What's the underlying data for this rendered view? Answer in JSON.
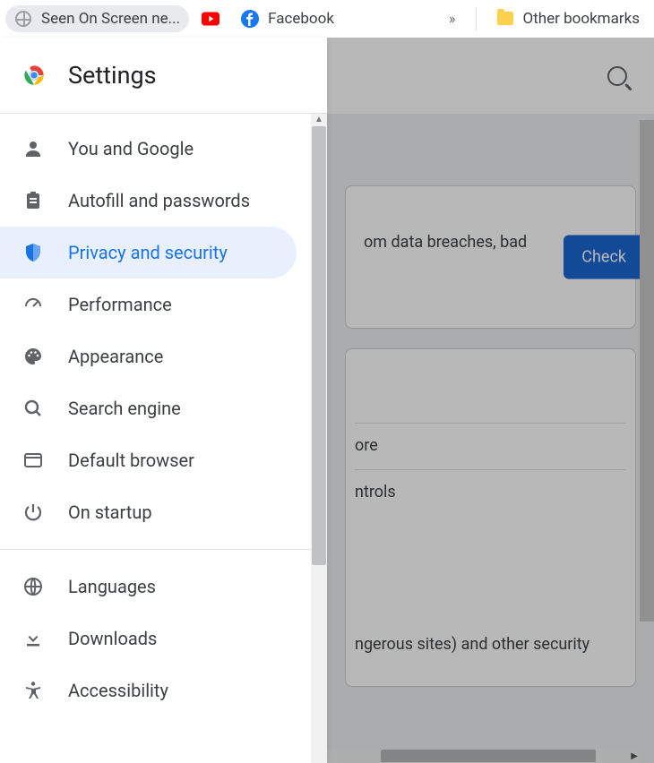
{
  "bookmarks": {
    "seen": "Seen On Screen ne...",
    "facebook": "Facebook",
    "other": "Other bookmarks",
    "overflow": "»"
  },
  "drawer": {
    "title": "Settings",
    "groups": {
      "primary": [
        {
          "id": "you-and-google",
          "label": "You and Google",
          "icon": "person"
        },
        {
          "id": "autofill",
          "label": "Autofill and passwords",
          "icon": "assignment"
        },
        {
          "id": "privacy",
          "label": "Privacy and security",
          "icon": "shield",
          "selected": true
        },
        {
          "id": "performance",
          "label": "Performance",
          "icon": "speed"
        },
        {
          "id": "appearance",
          "label": "Appearance",
          "icon": "palette"
        },
        {
          "id": "search-engine",
          "label": "Search engine",
          "icon": "search"
        },
        {
          "id": "default-browser",
          "label": "Default browser",
          "icon": "browser"
        },
        {
          "id": "on-startup",
          "label": "On startup",
          "icon": "power"
        }
      ],
      "secondary": [
        {
          "id": "languages",
          "label": "Languages",
          "icon": "globe"
        },
        {
          "id": "downloads",
          "label": "Downloads",
          "icon": "download"
        },
        {
          "id": "accessibility",
          "label": "Accessibility",
          "icon": "accessibility"
        }
      ]
    }
  },
  "page": {
    "safety_snippet": "om data breaches, bad",
    "check_button": "Check",
    "more_row": "ore",
    "controls_row": "ntrols",
    "long_row": "ngerous sites) and other security"
  }
}
